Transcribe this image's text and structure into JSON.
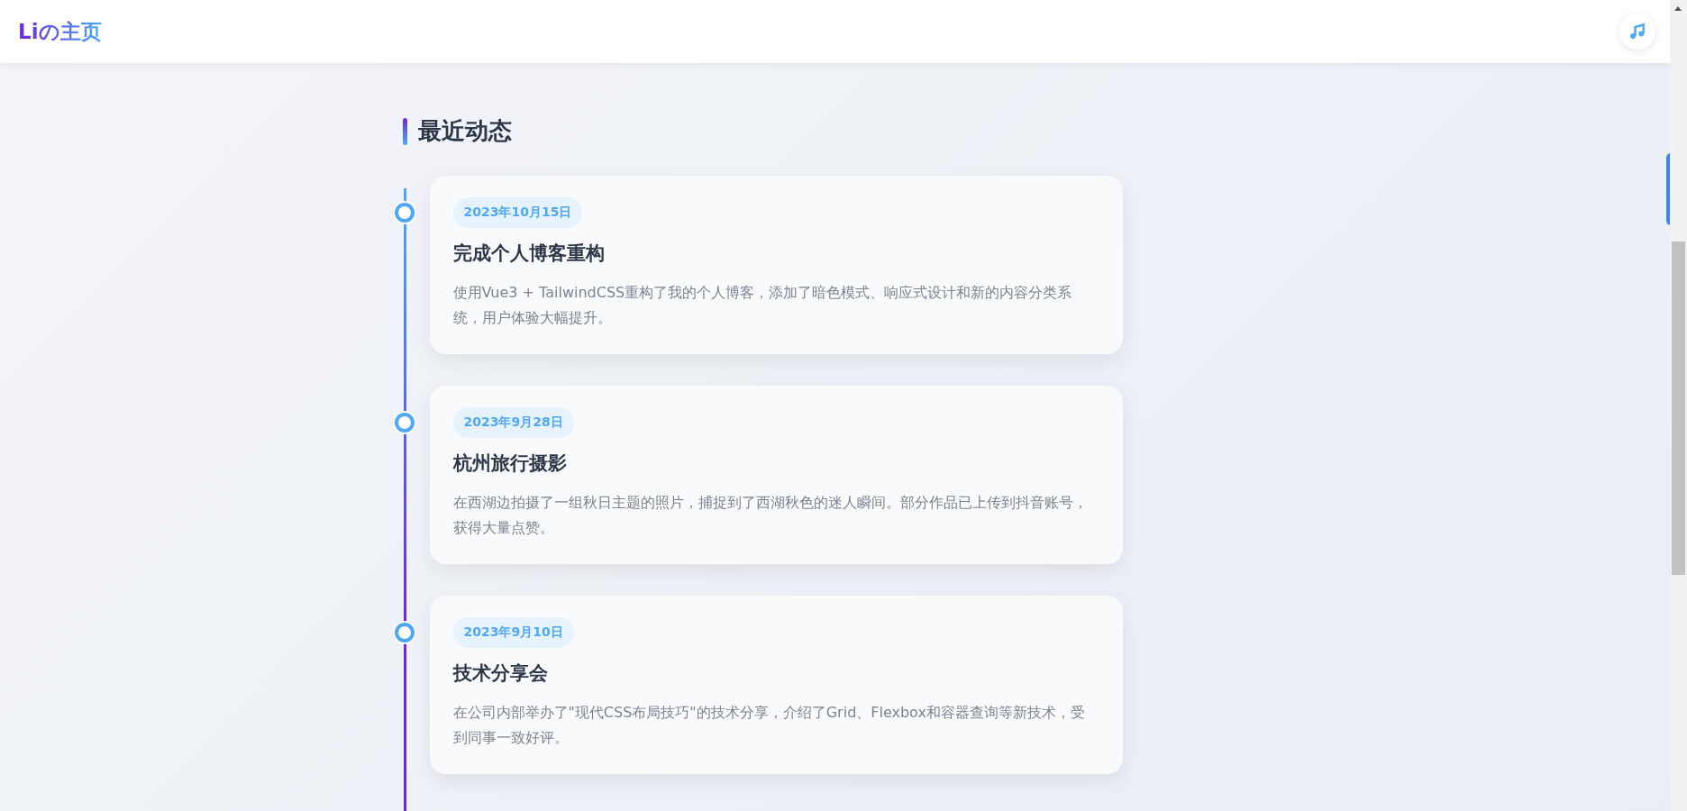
{
  "header": {
    "logo": "Liの主页"
  },
  "section": {
    "title": "最近动态"
  },
  "timeline": [
    {
      "date": "2023年10月15日",
      "title": "完成个人博客重构",
      "description": "使用Vue3 + TailwindCSS重构了我的个人博客，添加了暗色模式、响应式设计和新的内容分类系统，用户体验大幅提升。"
    },
    {
      "date": "2023年9月28日",
      "title": "杭州旅行摄影",
      "description": "在西湖边拍摄了一组秋日主题的照片，捕捉到了西湖秋色的迷人瞬间。部分作品已上传到抖音账号，获得大量点赞。"
    },
    {
      "date": "2023年9月10日",
      "title": "技术分享会",
      "description": "在公司内部举办了\"现代CSS布局技巧\"的技术分享，介绍了Grid、Flexbox和容器查询等新技术，受到同事一致好评。"
    }
  ]
}
